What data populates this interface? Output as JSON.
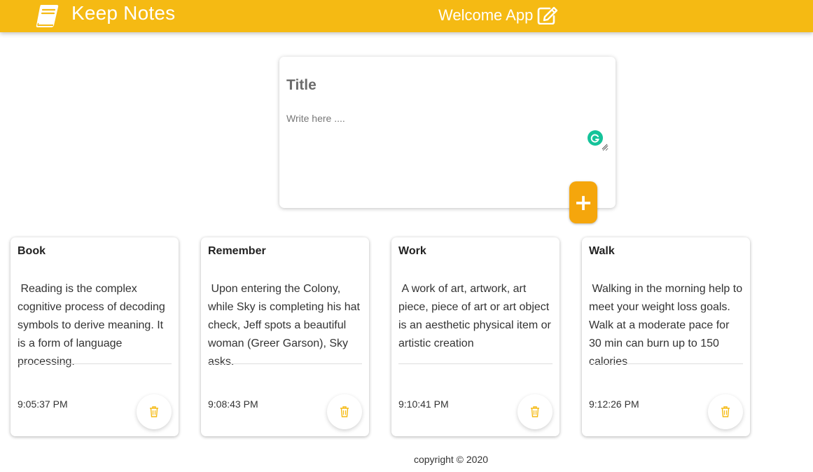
{
  "header": {
    "brand_title": "Keep Notes",
    "center_label": "Welcome App",
    "background_color": "#f5ba13",
    "brand_icon": "book-icon",
    "center_icon": "edit-icon"
  },
  "composer": {
    "title_placeholder": "Title",
    "content_placeholder": "Write here ....",
    "add_label": "+",
    "add_color": "#f5a60c"
  },
  "notes": [
    {
      "title": "Book",
      "content": " Reading is the complex cognitive process of decoding symbols to derive meaning. It is a form of language processing.",
      "time": "9:05:37 PM"
    },
    {
      "title": "Remember",
      "content": " Upon entering the Colony, while Sky is completing his hat check, Jeff spots a beautiful woman (Greer Garson), Sky asks.",
      "time": "9:08:43 PM"
    },
    {
      "title": "Work",
      "content": " A work of art, artwork, art piece, piece of art or art object is an aesthetic physical item or artistic creation",
      "time": "9:10:41 PM"
    },
    {
      "title": "Walk",
      "content": " Walking in the morning help to meet your weight loss goals. Walk at a moderate pace for 30 min can burn up to 150 calories",
      "time": "9:12:26 PM"
    }
  ],
  "footer": {
    "copyright": "copyright © 2020"
  }
}
